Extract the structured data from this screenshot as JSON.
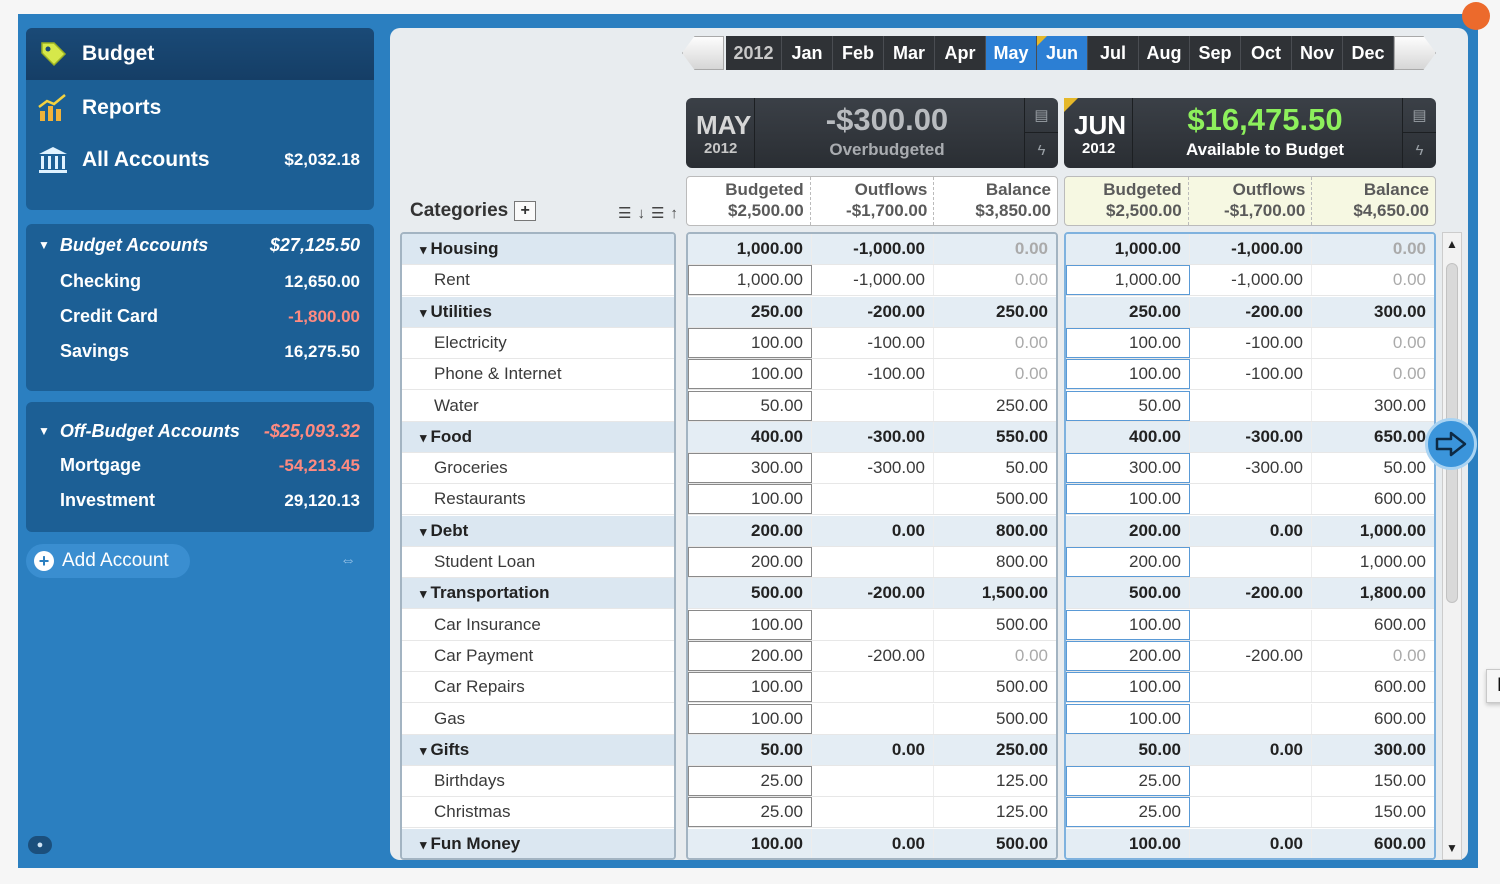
{
  "sidebar": {
    "nav": [
      {
        "label": "Budget",
        "icon": "tag-icon"
      },
      {
        "label": "Reports",
        "icon": "chart-icon"
      },
      {
        "label": "All Accounts",
        "icon": "bank-icon",
        "amount": "$2,032.18"
      }
    ],
    "budget_accounts": {
      "title": "Budget Accounts",
      "total": "$27,125.50",
      "accounts": [
        {
          "name": "Checking",
          "amount": "12,650.00"
        },
        {
          "name": "Credit Card",
          "amount": "-1,800.00"
        },
        {
          "name": "Savings",
          "amount": "16,275.50"
        }
      ]
    },
    "off_budget_accounts": {
      "title": "Off-Budget Accounts",
      "total": "-$25,093.32",
      "accounts": [
        {
          "name": "Mortgage",
          "amount": "-54,213.45"
        },
        {
          "name": "Investment",
          "amount": "29,120.13"
        }
      ]
    },
    "add_account_label": "Add Account"
  },
  "month_bar": {
    "year": "2012",
    "months": [
      "Jan",
      "Feb",
      "Mar",
      "Apr",
      "May",
      "Jun",
      "Jul",
      "Aug",
      "Sep",
      "Oct",
      "Nov",
      "Dec"
    ],
    "selected": [
      "May",
      "Jun"
    ]
  },
  "summary_may": {
    "month": "MAY",
    "year": "2012",
    "amount": "-$300.00",
    "label": "Overbudgeted"
  },
  "summary_jun": {
    "month": "JUN",
    "year": "2012",
    "amount": "$16,475.50",
    "label": "Available to Budget"
  },
  "categories_label": "Categories",
  "columns": {
    "may": {
      "budgeted": "Budgeted",
      "budgeted_total": "$2,500.00",
      "outflows": "Outflows",
      "outflows_total": "-$1,700.00",
      "balance": "Balance",
      "balance_total": "$3,850.00"
    },
    "jun": {
      "budgeted": "Budgeted",
      "budgeted_total": "$2,500.00",
      "outflows": "Outflows",
      "outflows_total": "-$1,700.00",
      "balance": "Balance",
      "balance_total": "$4,650.00"
    }
  },
  "rows": [
    {
      "name": "Housing",
      "group": true,
      "may": [
        "1,000.00",
        "-1,000.00",
        "0.00"
      ],
      "jun": [
        "1,000.00",
        "-1,000.00",
        "0.00"
      ]
    },
    {
      "name": "Rent",
      "group": false,
      "may": [
        "1,000.00",
        "-1,000.00",
        "0.00"
      ],
      "jun": [
        "1,000.00",
        "-1,000.00",
        "0.00"
      ]
    },
    {
      "name": "Utilities",
      "group": true,
      "may": [
        "250.00",
        "-200.00",
        "250.00"
      ],
      "jun": [
        "250.00",
        "-200.00",
        "300.00"
      ]
    },
    {
      "name": "Electricity",
      "group": false,
      "may": [
        "100.00",
        "-100.00",
        "0.00"
      ],
      "jun": [
        "100.00",
        "-100.00",
        "0.00"
      ]
    },
    {
      "name": "Phone & Internet",
      "group": false,
      "may": [
        "100.00",
        "-100.00",
        "0.00"
      ],
      "jun": [
        "100.00",
        "-100.00",
        "0.00"
      ]
    },
    {
      "name": "Water",
      "group": false,
      "may": [
        "50.00",
        "",
        "250.00"
      ],
      "jun": [
        "50.00",
        "",
        "300.00"
      ]
    },
    {
      "name": "Food",
      "group": true,
      "may": [
        "400.00",
        "-300.00",
        "550.00"
      ],
      "jun": [
        "400.00",
        "-300.00",
        "650.00"
      ]
    },
    {
      "name": "Groceries",
      "group": false,
      "may": [
        "300.00",
        "-300.00",
        "50.00"
      ],
      "jun": [
        "300.00",
        "-300.00",
        "50.00"
      ]
    },
    {
      "name": "Restaurants",
      "group": false,
      "may": [
        "100.00",
        "",
        "500.00"
      ],
      "jun": [
        "100.00",
        "",
        "600.00"
      ]
    },
    {
      "name": "Debt",
      "group": true,
      "may": [
        "200.00",
        "0.00",
        "800.00"
      ],
      "jun": [
        "200.00",
        "0.00",
        "1,000.00"
      ]
    },
    {
      "name": "Student Loan",
      "group": false,
      "may": [
        "200.00",
        "",
        "800.00"
      ],
      "jun": [
        "200.00",
        "",
        "1,000.00"
      ]
    },
    {
      "name": "Transportation",
      "group": true,
      "may": [
        "500.00",
        "-200.00",
        "1,500.00"
      ],
      "jun": [
        "500.00",
        "-200.00",
        "1,800.00"
      ]
    },
    {
      "name": "Car Insurance",
      "group": false,
      "may": [
        "100.00",
        "",
        "500.00"
      ],
      "jun": [
        "100.00",
        "",
        "600.00"
      ]
    },
    {
      "name": "Car Payment",
      "group": false,
      "may": [
        "200.00",
        "-200.00",
        "0.00"
      ],
      "jun": [
        "200.00",
        "-200.00",
        "0.00"
      ]
    },
    {
      "name": "Car Repairs",
      "group": false,
      "may": [
        "100.00",
        "",
        "500.00"
      ],
      "jun": [
        "100.00",
        "",
        "600.00"
      ]
    },
    {
      "name": "Gas",
      "group": false,
      "may": [
        "100.00",
        "",
        "500.00"
      ],
      "jun": [
        "100.00",
        "",
        "600.00"
      ]
    },
    {
      "name": "Gifts",
      "group": true,
      "may": [
        "50.00",
        "0.00",
        "250.00"
      ],
      "jun": [
        "50.00",
        "0.00",
        "300.00"
      ]
    },
    {
      "name": "Birthdays",
      "group": false,
      "may": [
        "25.00",
        "",
        "125.00"
      ],
      "jun": [
        "25.00",
        "",
        "150.00"
      ]
    },
    {
      "name": "Christmas",
      "group": false,
      "may": [
        "25.00",
        "",
        "125.00"
      ],
      "jun": [
        "25.00",
        "",
        "150.00"
      ]
    },
    {
      "name": "Fun Money",
      "group": true,
      "may": [
        "100.00",
        "0.00",
        "500.00"
      ],
      "jun": [
        "100.00",
        "0.00",
        "600.00"
      ]
    }
  ],
  "tooltip": "Next",
  "colors": {
    "sidebar_bg": "#2b7fc0",
    "selected_month": "#2c7fd4",
    "available_green": "#8df05c",
    "negative": "#ff8a80"
  }
}
